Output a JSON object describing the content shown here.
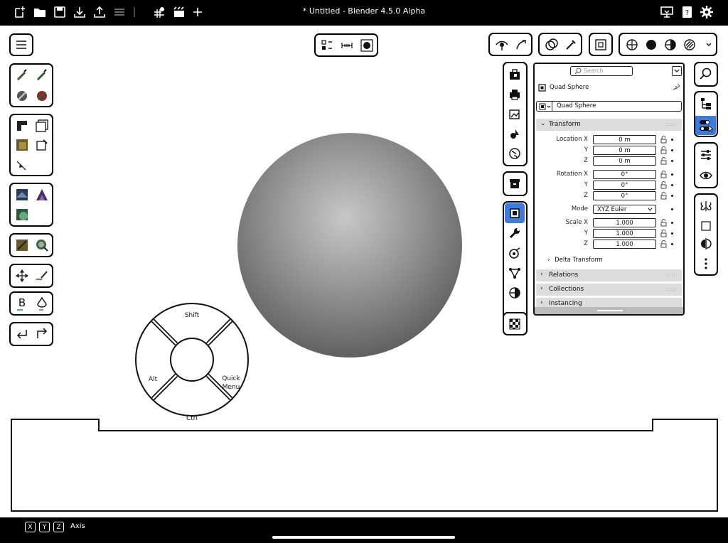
{
  "window": {
    "title": "* Untitled - Blender 4.5.0 Alpha"
  },
  "colors": {
    "accent": "#3d7be0",
    "bar": "#000000",
    "section": "#dddddd"
  },
  "topbar": {
    "left_icons": [
      "new-file-icon",
      "open-folder-icon",
      "save-icon",
      "import-icon",
      "export-icon",
      "menu-lines-icon",
      "snap-icon",
      "scene-icon",
      "add-icon"
    ],
    "right_icons": [
      "display-icon",
      "help-book-icon",
      "settings-gear-icon"
    ]
  },
  "panel": {
    "search_placeholder": "Search",
    "object_name": "Quad Sphere",
    "data_name": "Quad Sphere",
    "transform": {
      "title": "Transform",
      "location_label": "Location X",
      "location": [
        "0 m",
        "0 m",
        "0 m"
      ],
      "rotation_label": "Rotation X",
      "rotation": [
        "0°",
        "0°",
        "0°"
      ],
      "mode_label": "Mode",
      "mode": "XYZ Euler",
      "scale_label": "Scale X",
      "scale": [
        "1.000",
        "1.000",
        "1.000"
      ],
      "y": "Y",
      "z": "Z"
    },
    "delta": "Delta Transform",
    "sections": [
      "Relations",
      "Collections",
      "Instancing"
    ]
  },
  "pie": {
    "top": "Shift",
    "left": "Alt",
    "right_line1": "Quick",
    "right_line2": "Menu",
    "bottom": "Ctrl"
  },
  "statusbar": {
    "keys": [
      "X",
      "Y",
      "Z"
    ],
    "label": "Axis"
  }
}
